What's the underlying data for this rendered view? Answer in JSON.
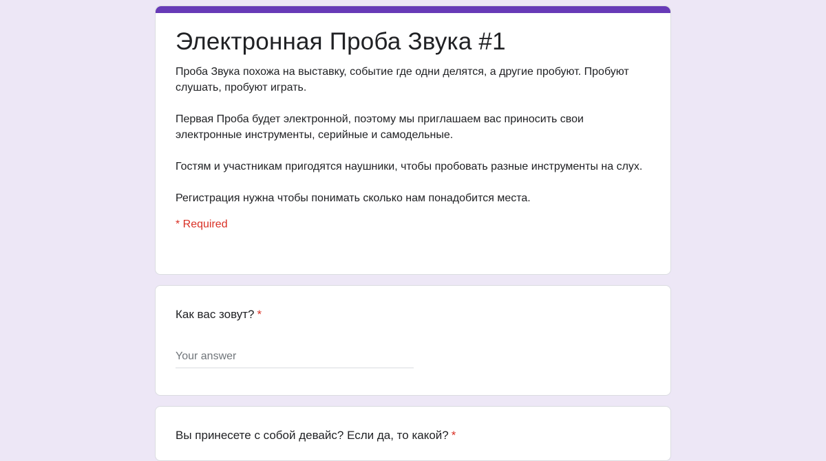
{
  "form": {
    "title": "Электронная Проба Звука #1",
    "description": [
      "Проба Звука похожа на выставку, событие где одни делятся, а другие пробуют. Пробуют слушать, пробуют играть.",
      "Первая Проба будет электронной, поэтому мы приглашаем вас приносить свои электронные инструменты, серийные и самодельные.",
      "Гостям и участникам пригодятся наушники, чтобы пробовать разные инструменты на слух.",
      "Регистрация нужна чтобы понимать сколько нам понадобится места."
    ],
    "required_note": "* Required"
  },
  "questions": [
    {
      "label": "Как вас зовут?",
      "required_mark": "*",
      "placeholder": "Your answer"
    },
    {
      "label": "Вы принесете с собой девайс? Если да, то какой?",
      "required_mark": "*"
    }
  ],
  "colors": {
    "accent": "#673ab7",
    "background": "#ede7f6",
    "required": "#d93025"
  }
}
